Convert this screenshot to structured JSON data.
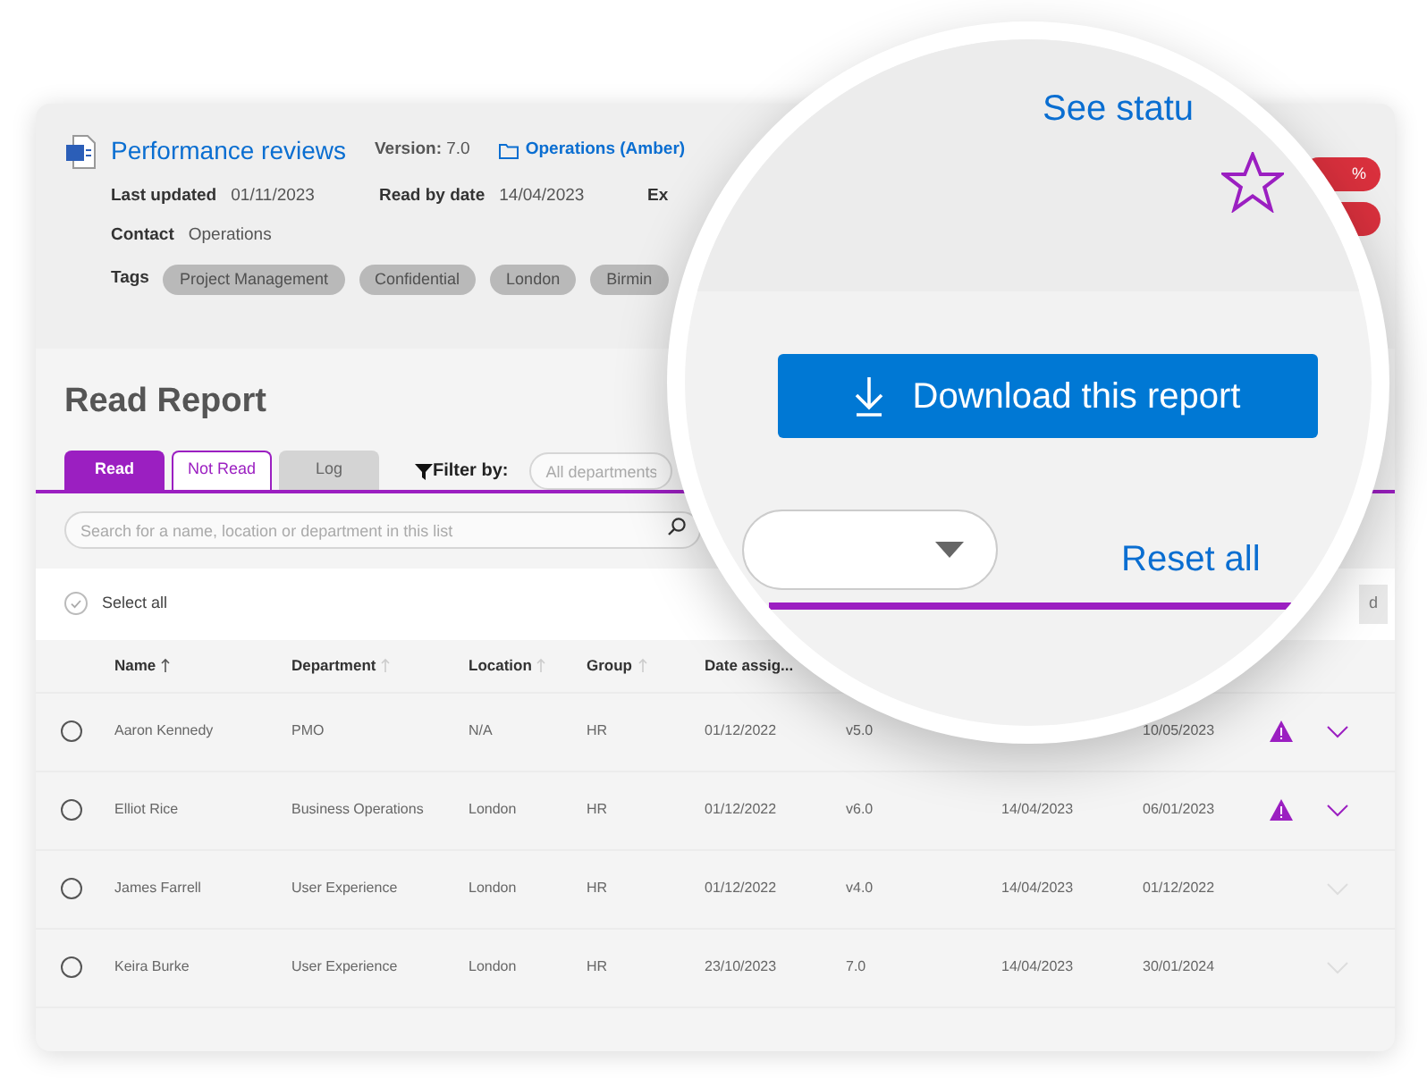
{
  "document": {
    "title": "Performance reviews",
    "version_label": "Version:",
    "version": "7.0",
    "folder": "Operations (Amber)",
    "fields": [
      {
        "label": "Last updated",
        "value": "01/11/2023"
      },
      {
        "label": "Read by date",
        "value": "14/04/2023"
      },
      {
        "label": "Ex"
      }
    ],
    "contact": {
      "label": "Contact",
      "value": "Operations"
    },
    "tags_label": "Tags",
    "tags": [
      "Project Management",
      "Confidential",
      "London",
      "Birmin"
    ],
    "pills": [
      {
        "kind": "label",
        "text": "%"
      },
      {
        "kind": "plain"
      }
    ]
  },
  "report": {
    "title": "Read Report",
    "tabs": [
      {
        "label": "Read",
        "selected": true,
        "disabled": false
      },
      {
        "label": "Not Read",
        "selected": false,
        "disabled": false
      },
      {
        "label": "Log",
        "selected": false,
        "disabled": true
      }
    ],
    "filter_label": "Filter by:",
    "department_filter": {
      "placeholder": "All departments"
    },
    "search": {
      "placeholder": "Search for a name, location or department in this list"
    },
    "select_all": {
      "label": "Select all",
      "checked": false
    },
    "partial_button": {
      "label": "d"
    },
    "table": {
      "columns": [
        {
          "label": "Name",
          "sort_active": true
        },
        {
          "label": "Department",
          "sort_active": false
        },
        {
          "label": "Location",
          "sort_active": false
        },
        {
          "label": "Group",
          "sort_active": false
        },
        {
          "label": "Date assig..."
        }
      ],
      "rows": [
        {
          "selected": false,
          "name": "Aaron Kennedy",
          "department": "PMO",
          "location": "N/A",
          "group": "HR",
          "date_assigned": "01/12/2022",
          "column_6": "v5.0",
          "column_8": "10/05/2023",
          "warning": true,
          "expandable": true
        },
        {
          "selected": false,
          "name": "Elliot Rice",
          "department": "Business Operations",
          "location": "London",
          "group": "HR",
          "date_assigned": "01/12/2022",
          "column_6": "v6.0",
          "column_7": "14/04/2023",
          "column_8": "06/01/2023",
          "warning": true,
          "expandable": true
        },
        {
          "selected": false,
          "name": "James Farrell",
          "department": "User Experience",
          "location": "London",
          "group": "HR",
          "date_assigned": "01/12/2022",
          "column_6": "v4.0",
          "column_7": "14/04/2023",
          "column_8": "01/12/2022",
          "warning": false,
          "expandable": false
        },
        {
          "selected": false,
          "name": "Keira Burke",
          "department": "User Experience",
          "location": "London",
          "group": "HR",
          "date_assigned": "23/10/2023",
          "column_6": "7.0",
          "column_7": "14/04/2023",
          "column_8": "30/01/2024",
          "warning": false,
          "expandable": false
        }
      ]
    }
  },
  "magnifier": {
    "status_link": "See statu",
    "starred": false,
    "download_button": "Download this report",
    "reset_link": "Reset all"
  }
}
